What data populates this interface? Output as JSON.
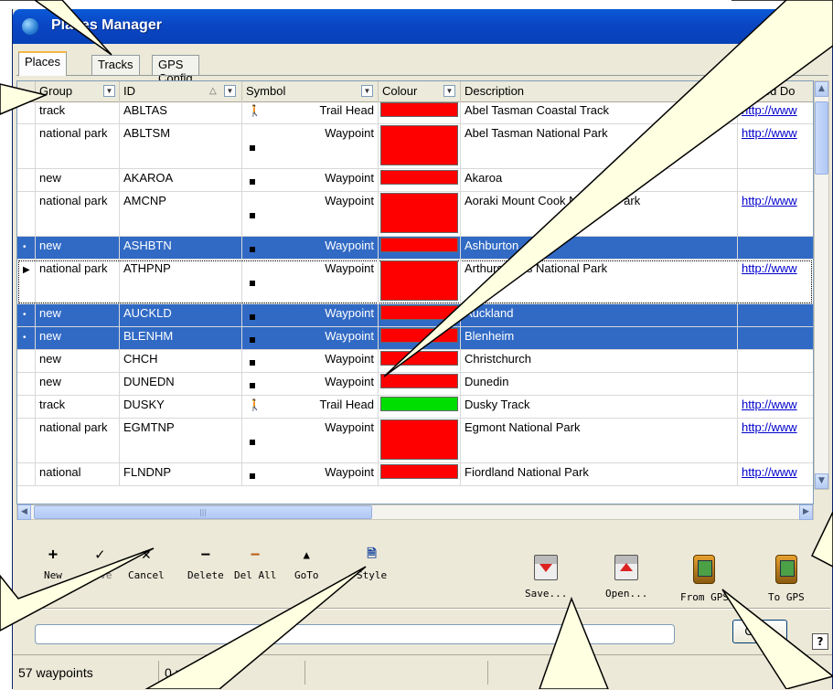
{
  "window": {
    "title": "Places Manager"
  },
  "tabs": [
    {
      "label": "Places",
      "mnemonic": "P",
      "rest": "laces"
    },
    {
      "label": "Tracks",
      "pre": "Tra",
      "mnemonic": "c",
      "rest": "ks"
    },
    {
      "label": "GPS Config"
    }
  ],
  "columns": {
    "group": "Group",
    "id": "ID",
    "symbol": "Symbol",
    "colour": "Colour",
    "description": "Description",
    "linked": "Linked Do"
  },
  "colors": {
    "red": "#ff0000",
    "green": "#00dd00",
    "selection": "#316ac5"
  },
  "rows": [
    {
      "group": "track",
      "id": "ABLTAS",
      "symbol": "Trail Head",
      "icon": "hiker-icon",
      "colour": "red",
      "description": "Abel Tasman Coastal Track",
      "link": "http://www",
      "tall": false,
      "selected": false
    },
    {
      "group": "national park",
      "id": "ABLTSM",
      "symbol": "Waypoint",
      "icon": "waypoint-icon",
      "colour": "red",
      "description": "Abel Tasman National Park",
      "link": "http://www",
      "tall": true,
      "selected": false
    },
    {
      "group": "new",
      "id": "AKAROA",
      "symbol": "Waypoint",
      "icon": "waypoint-icon",
      "colour": "red",
      "description": "Akaroa",
      "link": "",
      "tall": false,
      "selected": false
    },
    {
      "group": "national park",
      "id": "AMCNP",
      "symbol": "Waypoint",
      "icon": "waypoint-icon",
      "colour": "red",
      "description": "Aoraki Mount Cook National Park",
      "link": "http://www",
      "tall": true,
      "selected": false
    },
    {
      "group": "new",
      "id": "ASHBTN",
      "symbol": "Waypoint",
      "icon": "waypoint-icon",
      "colour": "red",
      "description": "Ashburton",
      "link": "",
      "tall": false,
      "selected": true,
      "indicator": "•"
    },
    {
      "group": "national park",
      "id": "ATHPNP",
      "symbol": "Waypoint",
      "icon": "waypoint-icon",
      "colour": "red",
      "description": "Arthurs Pass National Park",
      "link": "http://www",
      "tall": true,
      "selected": false,
      "current": true,
      "indicator": "▶"
    },
    {
      "group": "new",
      "id": "AUCKLD",
      "symbol": "Waypoint",
      "icon": "waypoint-icon",
      "colour": "red",
      "description": "Auckland",
      "link": "",
      "tall": false,
      "selected": true,
      "indicator": "•"
    },
    {
      "group": "new",
      "id": "BLENHM",
      "symbol": "Waypoint",
      "icon": "waypoint-icon",
      "colour": "red",
      "description": "Blenheim",
      "link": "",
      "tall": false,
      "selected": true,
      "indicator": "•"
    },
    {
      "group": "new",
      "id": "CHCH",
      "symbol": "Waypoint",
      "icon": "waypoint-icon",
      "colour": "red",
      "description": "Christchurch",
      "link": "",
      "tall": false,
      "selected": false
    },
    {
      "group": "new",
      "id": "DUNEDN",
      "symbol": "Waypoint",
      "icon": "waypoint-icon",
      "colour": "red",
      "description": "Dunedin",
      "link": "",
      "tall": false,
      "selected": false
    },
    {
      "group": "track",
      "id": "DUSKY",
      "symbol": "Trail Head",
      "icon": "hiker-icon",
      "colour": "green",
      "description": "Dusky Track",
      "link": "http://www",
      "tall": false,
      "selected": false
    },
    {
      "group": "national park",
      "id": "EGMTNP",
      "symbol": "Waypoint",
      "icon": "waypoint-icon",
      "colour": "red",
      "description": "Egmont National Park",
      "link": "http://www",
      "tall": true,
      "selected": false
    },
    {
      "group": "national",
      "id": "FLNDNP",
      "symbol": "Waypoint",
      "icon": "waypoint-icon",
      "colour": "red",
      "description": "Fiordland National Park",
      "link": "http://www",
      "tall": false,
      "selected": false
    }
  ],
  "toolbar": {
    "new": "New",
    "save": "Save",
    "cancel": "Cancel",
    "delete": "Delete",
    "del_all": "Del All",
    "goto": "GoTo",
    "style": "Style",
    "save_file": "Save...",
    "open_file": "Open...",
    "from_gps": "From GPS",
    "to_gps": "To GPS"
  },
  "buttons": {
    "close": "Close",
    "help": "?"
  },
  "status": {
    "waypoints": "57 waypoints",
    "points": "0 points"
  }
}
